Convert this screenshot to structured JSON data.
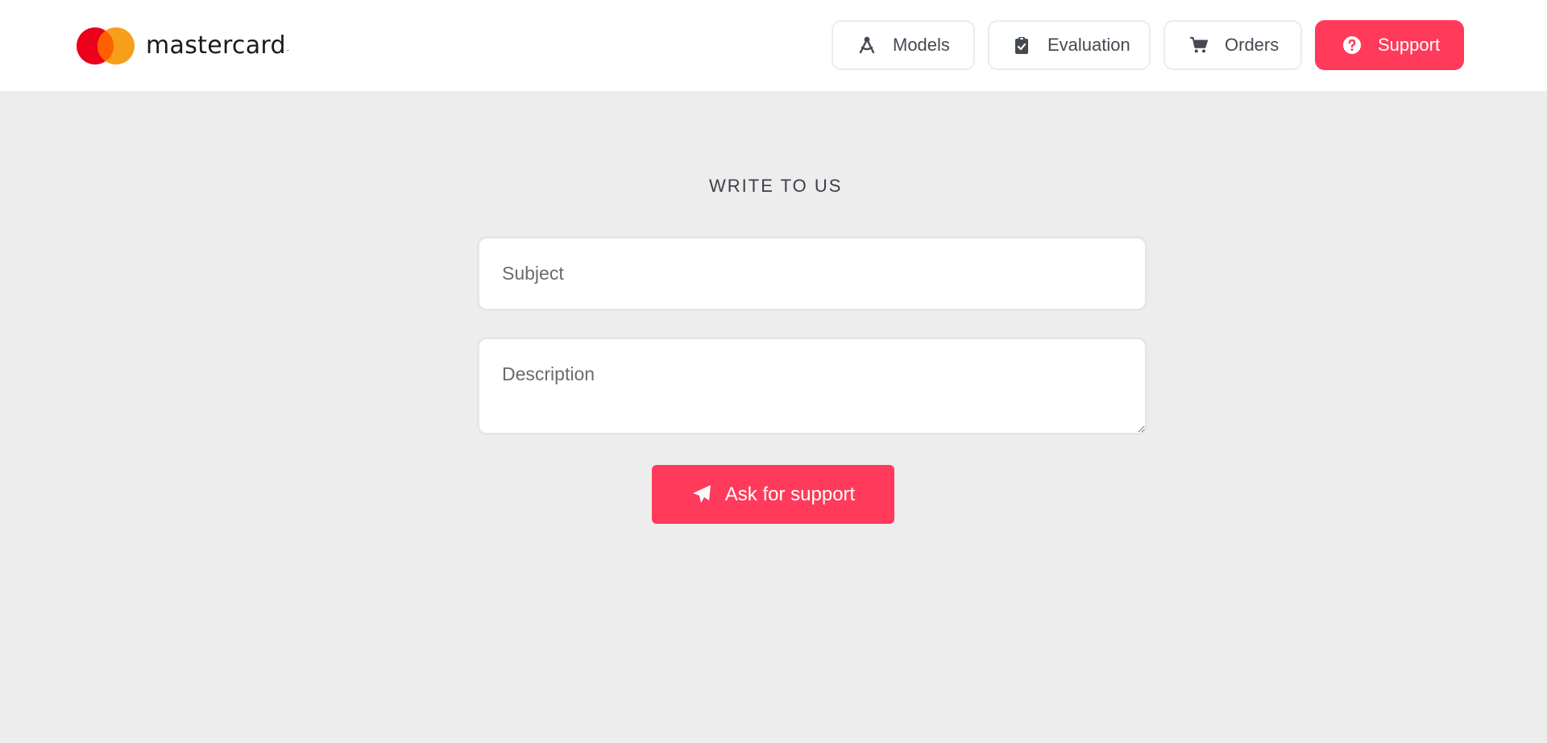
{
  "header": {
    "logo_text": "mastercard",
    "logo_dot": ".",
    "nav": [
      {
        "label": "Models",
        "icon": "compass-drafting-icon",
        "active": false
      },
      {
        "label": "Evaluation",
        "icon": "clipboard-check-icon",
        "active": false
      },
      {
        "label": "Orders",
        "icon": "cart-icon",
        "active": false
      },
      {
        "label": "Support",
        "icon": "question-circle-icon",
        "active": true
      }
    ]
  },
  "form": {
    "title": "WRITE TO US",
    "subject_placeholder": "Subject",
    "subject_value": "",
    "description_placeholder": "Description",
    "description_value": "",
    "submit_label": "Ask for support",
    "submit_icon": "paper-plane-icon"
  },
  "colors": {
    "accent": "#ff3a5a",
    "background": "#ededed",
    "logo_red": "#eb001b",
    "logo_orange": "#f79e1b"
  }
}
